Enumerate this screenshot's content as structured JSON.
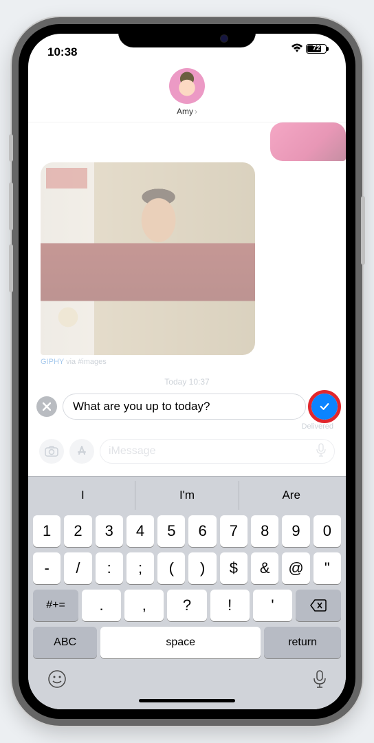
{
  "status": {
    "time": "10:38",
    "battery_pct": "72"
  },
  "header": {
    "contact_name": "Amy"
  },
  "conversation": {
    "gif_source_link": "GIPHY",
    "gif_source_suffix": " via #images",
    "timestamp": "Today 10:37",
    "delivered_label": "Delivered"
  },
  "edit": {
    "text": "What are you up to today?"
  },
  "compose": {
    "placeholder": "iMessage"
  },
  "keyboard": {
    "suggestions": [
      "I",
      "I'm",
      "Are"
    ],
    "row1": [
      "1",
      "2",
      "3",
      "4",
      "5",
      "6",
      "7",
      "8",
      "9",
      "0"
    ],
    "row2": [
      "-",
      "/",
      ":",
      ";",
      "(",
      ")",
      "$",
      "&",
      "@",
      "\""
    ],
    "row3_mid": [
      ".",
      ",",
      "?",
      "!",
      "'"
    ],
    "hash_key": "#+=",
    "abc_key": "ABC",
    "space_key": "space",
    "return_key": "return"
  }
}
